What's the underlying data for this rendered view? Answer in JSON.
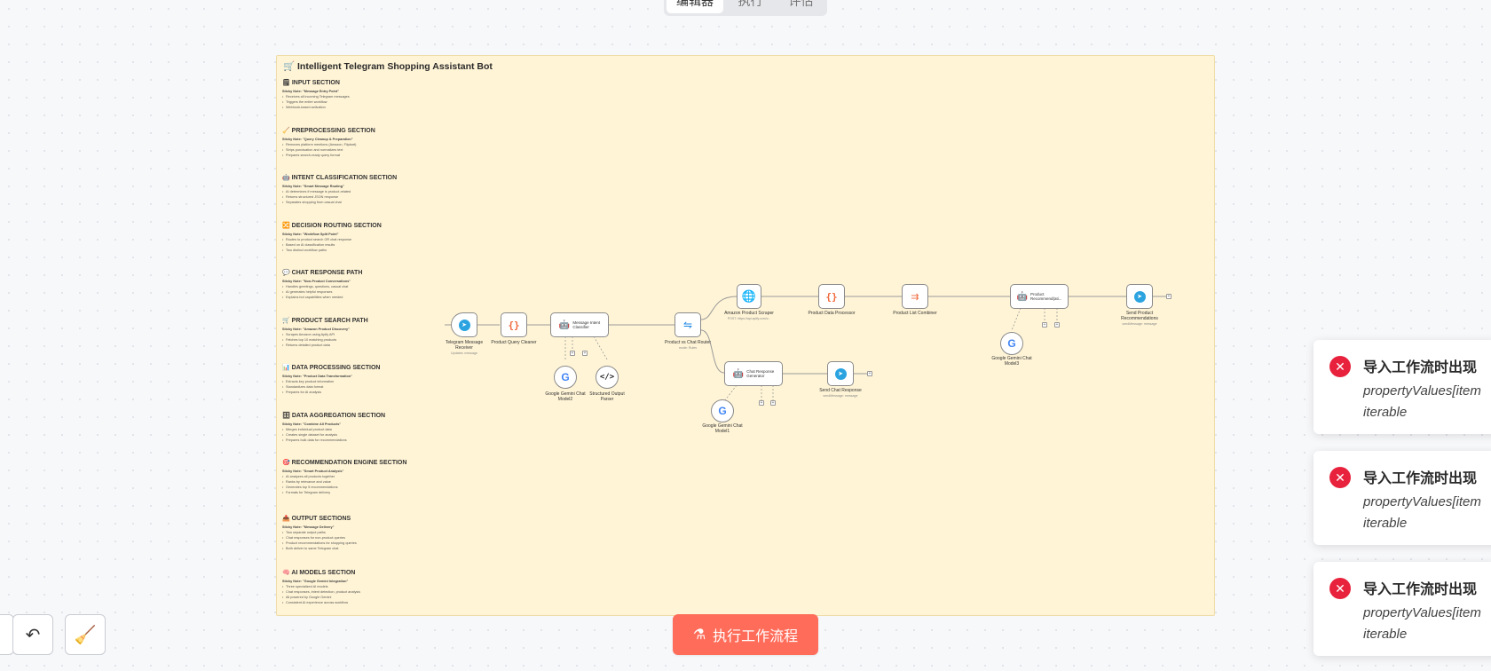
{
  "tabs": [
    {
      "label": "编辑器",
      "active": true
    },
    {
      "label": "执行",
      "active": false
    },
    {
      "label": "评估",
      "active": false
    }
  ],
  "sticky": {
    "title": "🛒 Intelligent Telegram Shopping Assistant Bot",
    "sections": [
      {
        "title": "🗒 INPUT SECTION",
        "sub": "Sticky Note: \"Message Entry Point\"",
        "bullets": [
          "Receives all incoming Telegram messages",
          "Triggers the entire workflow",
          "Webhook-based activation"
        ]
      },
      {
        "title": "🧹 PREPROCESSING SECTION",
        "sub": "Sticky Note: \"Query Cleanup & Preparation\"",
        "bullets": [
          "Removes platform mentions (Amazon, Flipkart)",
          "Strips punctuation and normalizes text",
          "Prepares search-ready query format"
        ]
      },
      {
        "title": "🤖 INTENT CLASSIFICATION SECTION",
        "sub": "Sticky Note: \"Smart Message Routing\"",
        "bullets": [
          "AI determines if message is product-related",
          "Returns structured JSON response",
          "Separates shopping from casual chat"
        ]
      },
      {
        "title": "🔀 DECISION ROUTING SECTION",
        "sub": "Sticky Note: \"Workflow Split Point\"",
        "bullets": [
          "Routes to product search OR chat response",
          "Based on AI classification results",
          "Two distinct workflow paths"
        ]
      },
      {
        "title": "💬 CHAT RESPONSE PATH",
        "sub": "Sticky Note: \"Non-Product Conversations\"",
        "bullets": [
          "Handles greetings, questions, casual chat",
          "AI generates helpful responses",
          "Explains bot capabilities when needed"
        ]
      },
      {
        "title": "🛒 PRODUCT SEARCH PATH",
        "sub": "Sticky Note: \"Amazon Product Discovery\"",
        "bullets": [
          "Scrapes Amazon using Apify API",
          "Fetches top 10 matching products",
          "Returns detailed product data"
        ]
      },
      {
        "title": "📊 DATA PROCESSING SECTION",
        "sub": "Sticky Note: \"Product Data Transformation\"",
        "bullets": [
          "Extracts key product information",
          "Standardizes data format",
          "Prepares for AI analysis"
        ]
      },
      {
        "title": "🗄 DATA AGGREGATION SECTION",
        "sub": "Sticky Note: \"Combine All Products\"",
        "bullets": [
          "Merges individual product data",
          "Creates single dataset for analysis",
          "Prepares bulk data for recommendations"
        ]
      },
      {
        "title": "🎯 RECOMMENDATION ENGINE SECTION",
        "sub": "Sticky Note: \"Smart Product Analysis\"",
        "bullets": [
          "AI analyzes all products together",
          "Ranks by relevance and value",
          "Generates top 5 recommendations",
          "Formats for Telegram delivery"
        ]
      },
      {
        "title": "📤 OUTPUT SECTIONS",
        "sub": "Sticky Note: \"Message Delivery\"",
        "bullets": [
          "Two separate output paths",
          "Chat responses for non-product queries",
          "Product recommendations for shopping queries",
          "Both deliver to same Telegram chat"
        ]
      },
      {
        "title": "🧠 AI MODELS SECTION",
        "sub": "Sticky Note: \"Google Gemini Integration\"",
        "bullets": [
          "Three specialized AI models",
          "Chat responses, intent detection, product analysis",
          "All powered by Google Gemini",
          "Consistent AI experience across workflow"
        ]
      }
    ]
  },
  "nodes": {
    "telegram_receiver": {
      "label": "Telegram Message\nReceiver",
      "sub": "Updates: message"
    },
    "query_cleaner": {
      "label": "Product Query Cleaner"
    },
    "intent_classifier": {
      "label": "Message Intent\nClassifier",
      "ports": [
        "Chat Model",
        "Memory",
        "Tool",
        "Output Parser"
      ]
    },
    "gemini2": {
      "label": "Google Gemini Chat\nModel2"
    },
    "output_parser": {
      "label": "Structured Output\nParser"
    },
    "router": {
      "label": "Product vs Chat Router",
      "sub": "mode: Rules"
    },
    "amazon_scraper": {
      "label": "Amazon Product Scraper",
      "sub": "POST: https://api.apify.com/v..."
    },
    "data_processor": {
      "label": "Product Data Processor"
    },
    "list_combiner": {
      "label": "Product List Combiner"
    },
    "recommender": {
      "label": "Product\nRecommend(ati...",
      "ports": [
        "Chat Model",
        "Memory",
        "Tool"
      ]
    },
    "gemini3": {
      "label": "Google Gemini Chat\nModel3"
    },
    "send_recommendations": {
      "label": "Send Product\nRecommendations",
      "sub": "sendMessage: message"
    },
    "chat_generator": {
      "label": "Chat Response\nGenerator",
      "ports": [
        "Chat Model",
        "Memory",
        "Tool"
      ]
    },
    "gemini1": {
      "label": "Google Gemini Chat\nModel1"
    },
    "send_chat": {
      "label": "Send Chat Response",
      "sub": "sendMessage: message"
    }
  },
  "actions": {
    "undo_icon": "undo-icon",
    "clean_icon": "broom-icon",
    "execute_label": "执行工作流程"
  },
  "toasts": [
    {
      "title": "导入工作流时出现",
      "message_line1": "propertyValues[item",
      "message_line2": "iterable"
    },
    {
      "title": "导入工作流时出现",
      "message_line1": "propertyValues[item",
      "message_line2": "iterable"
    },
    {
      "title": "导入工作流时出现",
      "message_line1": "propertyValues[item",
      "message_line2": "iterable"
    }
  ],
  "colors": {
    "accent": "#ff6d5a",
    "sticky_bg": "#fff4d6",
    "error": "#e8213c"
  }
}
